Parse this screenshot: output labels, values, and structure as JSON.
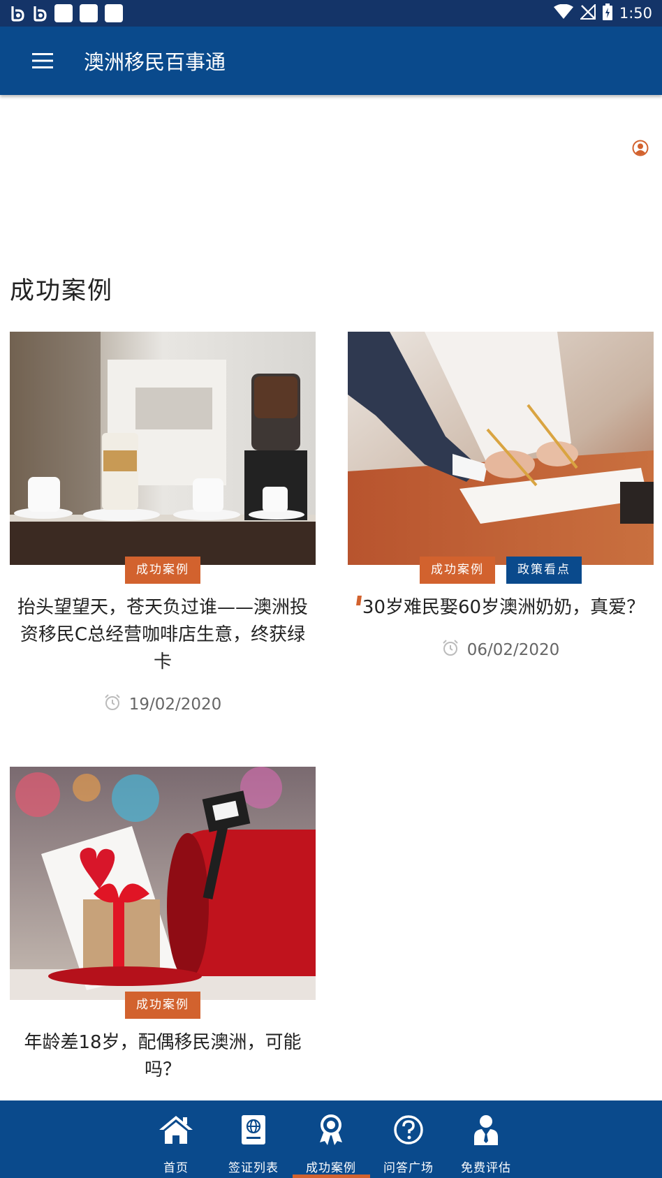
{
  "status_bar": {
    "time": "1:50",
    "notification_icons": [
      "b-app-icon",
      "b-app-icon",
      "square-icon",
      "square-icon",
      "square-icon"
    ],
    "system_icons": [
      "wifi-icon",
      "no-signal-icon",
      "battery-icon"
    ]
  },
  "app_bar": {
    "title": "澳洲移民百事通",
    "menu_icon": "menu-icon"
  },
  "main": {
    "section_title": "成功案例",
    "user_icon": "user-circle-icon",
    "cards": [
      {
        "image": "coffee-shop-photo",
        "tags": [
          "成功案例"
        ],
        "title": "抬头望望天，苍天负过谁——澳洲投资移民C总经营咖啡店生意，终获绿卡",
        "date": "19/02/2020"
      },
      {
        "image": "wedding-signing-photo",
        "tags": [
          "成功案例",
          "政策看点"
        ],
        "title": "30岁难民娶60岁澳洲奶奶，真爱？",
        "date": "06/02/2020"
      },
      {
        "image": "mailbox-gift-photo",
        "tags": [
          "成功案例"
        ],
        "title": "年龄差18岁，配偶移民澳洲，可能吗？",
        "date": ""
      }
    ]
  },
  "bottom_nav": {
    "items": [
      {
        "label": "首页",
        "icon": "home-icon",
        "active": false
      },
      {
        "label": "签证列表",
        "icon": "passport-icon",
        "active": false
      },
      {
        "label": "成功案例",
        "icon": "award-icon",
        "active": true
      },
      {
        "label": "问答广场",
        "icon": "question-icon",
        "active": false
      },
      {
        "label": "免费评估",
        "icon": "consultant-icon",
        "active": false
      }
    ]
  },
  "colors": {
    "status_bar": "#143468",
    "primary": "#0a4a8c",
    "accent": "#d2622e"
  }
}
